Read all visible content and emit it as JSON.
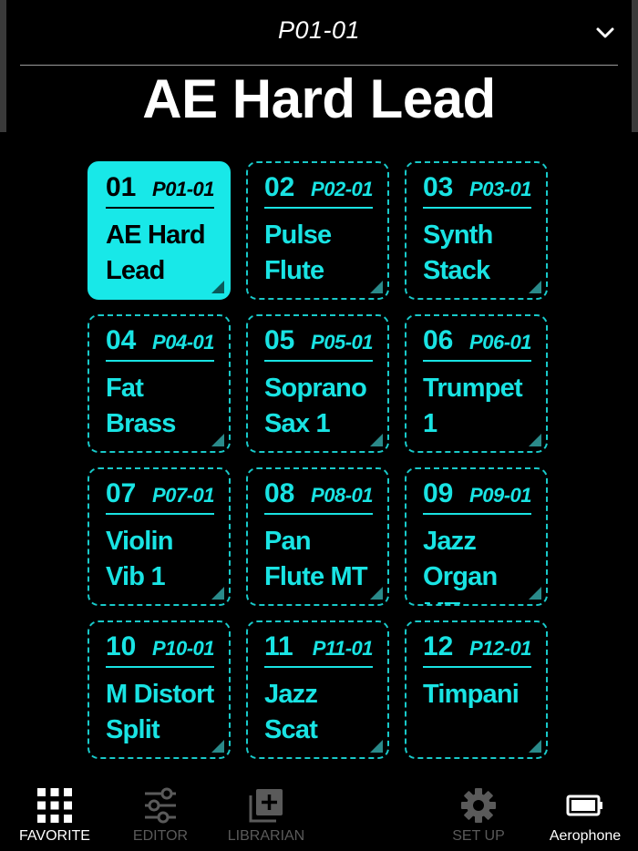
{
  "header": {
    "patch_number": "P01-01",
    "patch_name": "AE Hard Lead"
  },
  "favorites": [
    {
      "index": "01",
      "patch": "P01-01",
      "name": "AE Hard Lead",
      "selected": true
    },
    {
      "index": "02",
      "patch": "P02-01",
      "name": "Pulse Flute",
      "selected": false
    },
    {
      "index": "03",
      "patch": "P03-01",
      "name": "Synth Stack",
      "selected": false
    },
    {
      "index": "04",
      "patch": "P04-01",
      "name": "Fat Brass",
      "selected": false
    },
    {
      "index": "05",
      "patch": "P05-01",
      "name": "Soprano Sax 1",
      "selected": false
    },
    {
      "index": "06",
      "patch": "P06-01",
      "name": "Trumpet 1",
      "selected": false
    },
    {
      "index": "07",
      "patch": "P07-01",
      "name": "Violin Vib 1",
      "selected": false
    },
    {
      "index": "08",
      "patch": "P08-01",
      "name": "Pan Flute MT",
      "selected": false
    },
    {
      "index": "09",
      "patch": "P09-01",
      "name": "Jazz Organ MT",
      "selected": false
    },
    {
      "index": "10",
      "patch": "P10-01",
      "name": "M Distort Split",
      "selected": false
    },
    {
      "index": "11",
      "patch": "P11-01",
      "name": "Jazz Scat",
      "selected": false
    },
    {
      "index": "12",
      "patch": "P12-01",
      "name": "Timpani",
      "selected": false
    }
  ],
  "nav": {
    "favorite": {
      "label": "FAVORITE",
      "icon": "grid-icon",
      "state": "active"
    },
    "editor": {
      "label": "EDITOR",
      "icon": "sliders-icon",
      "state": "disabled"
    },
    "librarian": {
      "label": "LIBRARIAN",
      "icon": "library-add-icon",
      "state": "disabled"
    },
    "setup": {
      "label": "SET UP",
      "icon": "gear-icon",
      "state": "disabled"
    },
    "device": {
      "label": "Aerophone",
      "icon": "battery-icon",
      "state": "active"
    }
  },
  "colors": {
    "accent": "#18e8e8",
    "background": "#000000",
    "disabled": "#5a5a5a"
  }
}
